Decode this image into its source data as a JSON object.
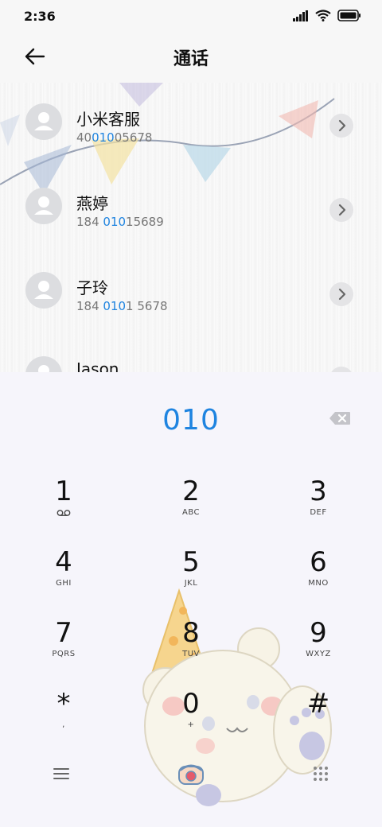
{
  "status_bar": {
    "time": "2:36"
  },
  "header": {
    "title": "通话"
  },
  "contacts": [
    {
      "name": "小米客服",
      "number_parts": [
        "40",
        "010",
        "05678"
      ]
    },
    {
      "name": "燕婷",
      "number_parts": [
        "184 ",
        "010",
        "15689"
      ]
    },
    {
      "name": "子玲",
      "number_parts": [
        "184 ",
        "010",
        "1 5678"
      ]
    },
    {
      "name": "Jason",
      "number_parts": [
        "",
        "",
        ""
      ]
    }
  ],
  "dialer": {
    "input": "010",
    "keys": [
      {
        "digit": "1",
        "sub": ""
      },
      {
        "digit": "2",
        "sub": "ABC"
      },
      {
        "digit": "3",
        "sub": "DEF"
      },
      {
        "digit": "4",
        "sub": "GHI"
      },
      {
        "digit": "5",
        "sub": "JKL"
      },
      {
        "digit": "6",
        "sub": "MNO"
      },
      {
        "digit": "7",
        "sub": "PQRS"
      },
      {
        "digit": "8",
        "sub": "TUV"
      },
      {
        "digit": "9",
        "sub": "WXYZ"
      },
      {
        "digit": "*",
        "sub": ","
      },
      {
        "digit": "0",
        "sub": "+"
      },
      {
        "digit": "#",
        "sub": ""
      }
    ]
  },
  "icons": {
    "back": "arrow-left-icon",
    "backspace": "backspace-icon",
    "voicemail": "voicemail-icon",
    "menu": "menu-icon",
    "call": "phone-call-icon",
    "keypad": "keypad-icon"
  },
  "colors": {
    "accent": "#1f84e0",
    "dialer_bg": "#f6f5fb"
  }
}
